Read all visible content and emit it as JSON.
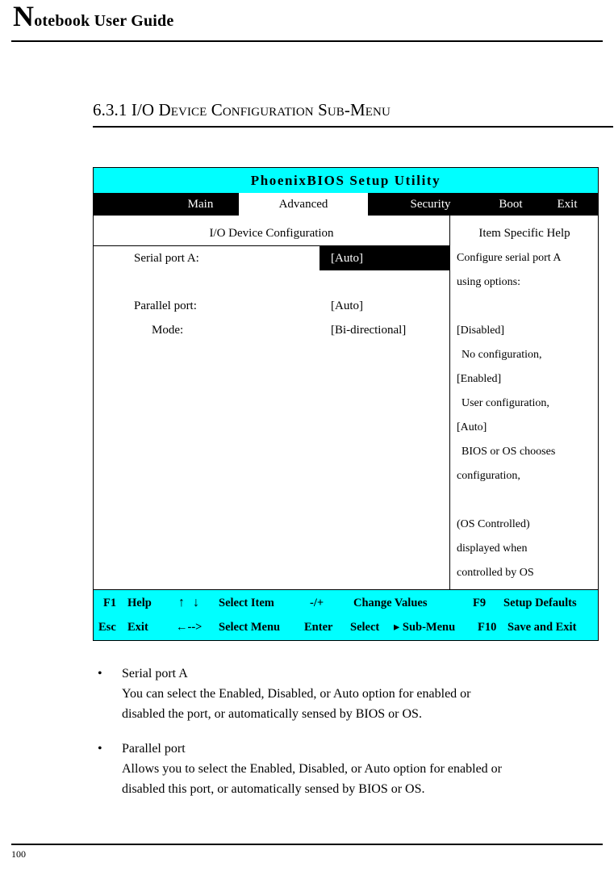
{
  "header": {
    "title_dropcap": "N",
    "title_rest": "otebook User Guide"
  },
  "section": {
    "heading": "6.3.1  I/O Device Configuration Sub-Menu"
  },
  "bios": {
    "title": "PhoenixBIOS Setup Utility",
    "colors": {
      "title_bar": "#00FFFF",
      "menu_bar": "#000000",
      "active_tab_bg": "#FFFFFF",
      "footer_bar": "#00FFFF",
      "highlight": "#000000"
    },
    "tabs": [
      {
        "label": "Main",
        "active": false
      },
      {
        "label": "Advanced",
        "active": true
      },
      {
        "label": "Security",
        "active": false
      },
      {
        "label": "Boot",
        "active": false
      },
      {
        "label": "Exit",
        "active": false
      }
    ],
    "panel_headers": {
      "left": "I/O Device Configuration",
      "right": "Item Specific Help"
    },
    "settings": [
      {
        "label": "Serial port A:",
        "value": "[Auto]",
        "selected": true,
        "indent": 0
      },
      {
        "label": "Parallel port:",
        "value": "[Auto]",
        "selected": false,
        "indent": 0
      },
      {
        "label": "Mode:",
        "value": "[Bi-directional]",
        "selected": false,
        "indent": 1
      }
    ],
    "help_lines": [
      "Configure serial port A",
      "using options:",
      "",
      "[Disabled]",
      "No configuration,",
      "[Enabled]",
      "User configuration,",
      "[Auto]",
      "BIOS or OS chooses",
      "configuration,",
      "",
      "(OS Controlled)",
      "displayed when",
      "controlled by OS"
    ],
    "footer_keys": {
      "f1": "F1",
      "help": "Help",
      "updown": "↑ ↓",
      "select_item": "Select Item",
      "plusminus": "-/+",
      "change_values": "Change Values",
      "f9": "F9",
      "setup_defaults": "Setup Defaults",
      "esc": "Esc",
      "exit": "Exit",
      "leftright": "←-->",
      "select_menu": "Select Menu",
      "enter": "Enter",
      "select": "Select",
      "submenu": "▸ Sub-Menu",
      "f10": "F10",
      "save_and_exit": "Save and Exit"
    }
  },
  "bullets": [
    {
      "glyph": "•",
      "title": "Serial port A",
      "body_line1": "You can select the Enabled, Disabled, or Auto option for enabled or",
      "body_line2": "disabled the port, or automatically sensed by BIOS or OS."
    },
    {
      "glyph": "•",
      "title": "Parallel port",
      "body_line1": "Allows you to select the Enabled, Disabled, or Auto option for enabled or",
      "body_line2": "disabled this port, or automatically sensed by BIOS or OS."
    }
  ],
  "page": {
    "number": "100"
  }
}
